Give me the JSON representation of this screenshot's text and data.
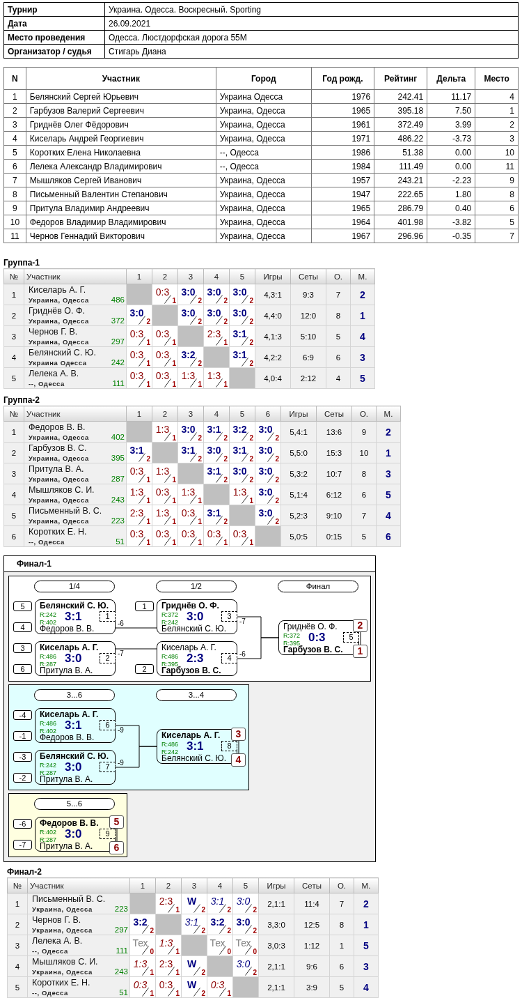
{
  "info": [
    {
      "label": "Турнир",
      "value": "Украина. Одесса. Воскресный. Sporting"
    },
    {
      "label": "Дата",
      "value": "26.09.2021"
    },
    {
      "label": "Место проведения",
      "value": "Одесса. Люстдорфская дорога 55М"
    },
    {
      "label": "Организатор / судья",
      "value": "Стигарь Диана"
    }
  ],
  "participants": {
    "columns": [
      "N",
      "Участник",
      "Город",
      "Год рожд.",
      "Рейтинг",
      "Дельта",
      "Место"
    ],
    "rows": [
      [
        "1",
        "Белянский Сергей Юрьевич",
        "Украина Одесса",
        "1976",
        "242.41",
        "11.17",
        "4"
      ],
      [
        "2",
        "Гарбузов Валерий Сергеевич",
        "Украина, Одесса",
        "1965",
        "395.18",
        "7.50",
        "1"
      ],
      [
        "3",
        "Гриднёв Олег Фёдорович",
        "Украина, Одесса",
        "1961",
        "372.49",
        "3.99",
        "2"
      ],
      [
        "4",
        "Киселарь Андрей Георгиевич",
        "Украина, Одесса",
        "1971",
        "486.22",
        "-3.73",
        "3"
      ],
      [
        "5",
        "Коротких Елена Николаевна",
        "--, Одесса",
        "1986",
        "51.38",
        "0.00",
        "10"
      ],
      [
        "6",
        "Лелека Александр Владимирович",
        "--, Одесса",
        "1984",
        "111.49",
        "0.00",
        "11"
      ],
      [
        "7",
        "Мышляков Сергей Иванович",
        "Украина, Одесса",
        "1957",
        "243.21",
        "-2.23",
        "9"
      ],
      [
        "8",
        "Письменный Валентин Степанович",
        "Украина, Одесса",
        "1947",
        "222.65",
        "1.80",
        "8"
      ],
      [
        "9",
        "Притула Владимир Андреевич",
        "Украина, Одесса",
        "1965",
        "286.79",
        "0.40",
        "6"
      ],
      [
        "10",
        "Федоров Владимир Владимирович",
        "Украина, Одесса",
        "1964",
        "401.98",
        "-3.82",
        "5"
      ],
      [
        "11",
        "Чернов Геннадий Викторович",
        "Украина, Одесса",
        "1967",
        "296.96",
        "-0.35",
        "7"
      ]
    ]
  },
  "groups": [
    {
      "title": "Группа-1",
      "columns": [
        "№",
        "Участник",
        "1",
        "2",
        "3",
        "4",
        "5",
        "Игры",
        "Сеты",
        "О.",
        "М."
      ],
      "rows": [
        {
          "no": "1",
          "name": "Киселарь А. Г.",
          "city": "Украина, Одесса",
          "rating": "486",
          "results": [
            {
              "kind": "blank"
            },
            {
              "kind": "loss",
              "score": "0:3",
              "points": "1"
            },
            {
              "kind": "win",
              "score": "3:0",
              "points": "2"
            },
            {
              "kind": "win",
              "score": "3:0",
              "points": "2"
            },
            {
              "kind": "win",
              "score": "3:0",
              "points": "2"
            }
          ],
          "games": "4,3:1",
          "sets": "9:3",
          "points": "7",
          "place": "2"
        },
        {
          "no": "2",
          "name": "Гриднёв О. Ф.",
          "city": "Украина, Одесса",
          "rating": "372",
          "results": [
            {
              "kind": "win",
              "score": "3:0",
              "points": "2"
            },
            {
              "kind": "blank"
            },
            {
              "kind": "win",
              "score": "3:0",
              "points": "2"
            },
            {
              "kind": "win",
              "score": "3:0",
              "points": "2"
            },
            {
              "kind": "win",
              "score": "3:0",
              "points": "2"
            }
          ],
          "games": "4,4:0",
          "sets": "12:0",
          "points": "8",
          "place": "1"
        },
        {
          "no": "3",
          "name": "Чернов Г. В.",
          "city": "Украина, Одесса",
          "rating": "297",
          "results": [
            {
              "kind": "loss",
              "score": "0:3",
              "points": "1"
            },
            {
              "kind": "loss",
              "score": "0:3",
              "points": "1"
            },
            {
              "kind": "blank"
            },
            {
              "kind": "loss",
              "score": "2:3",
              "points": "1"
            },
            {
              "kind": "win",
              "score": "3:1",
              "points": "2"
            }
          ],
          "games": "4,1:3",
          "sets": "5:10",
          "points": "5",
          "place": "4"
        },
        {
          "no": "4",
          "name": "Белянский С. Ю.",
          "city": "Украина Одесса",
          "rating": "242",
          "results": [
            {
              "kind": "loss",
              "score": "0:3",
              "points": "1"
            },
            {
              "kind": "loss",
              "score": "0:3",
              "points": "1"
            },
            {
              "kind": "win",
              "score": "3:2",
              "points": "2"
            },
            {
              "kind": "blank"
            },
            {
              "kind": "win",
              "score": "3:1",
              "points": "2"
            }
          ],
          "games": "4,2:2",
          "sets": "6:9",
          "points": "6",
          "place": "3"
        },
        {
          "no": "5",
          "name": "Лелека А. В.",
          "city": "--, Одесса",
          "rating": "111",
          "results": [
            {
              "kind": "loss",
              "score": "0:3",
              "points": "1"
            },
            {
              "kind": "loss",
              "score": "0:3",
              "points": "1"
            },
            {
              "kind": "loss",
              "score": "1:3",
              "points": "1"
            },
            {
              "kind": "loss",
              "score": "1:3",
              "points": "1"
            },
            {
              "kind": "blank"
            }
          ],
          "games": "4,0:4",
          "sets": "2:12",
          "points": "4",
          "place": "5"
        }
      ]
    },
    {
      "title": "Группа-2",
      "columns": [
        "№",
        "Участник",
        "1",
        "2",
        "3",
        "4",
        "5",
        "6",
        "Игры",
        "Сеты",
        "О.",
        "М."
      ],
      "rows": [
        {
          "no": "1",
          "name": "Федоров В. В.",
          "city": "Украина, Одесса",
          "rating": "402",
          "results": [
            {
              "kind": "blank"
            },
            {
              "kind": "loss",
              "score": "1:3",
              "points": "1"
            },
            {
              "kind": "win",
              "score": "3:0",
              "points": "2"
            },
            {
              "kind": "win",
              "score": "3:1",
              "points": "2"
            },
            {
              "kind": "win",
              "score": "3:2",
              "points": "2"
            },
            {
              "kind": "win",
              "score": "3:0",
              "points": "2"
            }
          ],
          "games": "5,4:1",
          "sets": "13:6",
          "points": "9",
          "place": "2"
        },
        {
          "no": "2",
          "name": "Гарбузов В. С.",
          "city": "Украина, Одесса",
          "rating": "395",
          "results": [
            {
              "kind": "win",
              "score": "3:1",
              "points": "2"
            },
            {
              "kind": "blank"
            },
            {
              "kind": "win",
              "score": "3:1",
              "points": "2"
            },
            {
              "kind": "win",
              "score": "3:0",
              "points": "2"
            },
            {
              "kind": "win",
              "score": "3:1",
              "points": "2"
            },
            {
              "kind": "win",
              "score": "3:0",
              "points": "2"
            }
          ],
          "games": "5,5:0",
          "sets": "15:3",
          "points": "10",
          "place": "1"
        },
        {
          "no": "3",
          "name": "Притула В. А.",
          "city": "Украина, Одесса",
          "rating": "287",
          "results": [
            {
              "kind": "loss",
              "score": "0:3",
              "points": "1"
            },
            {
              "kind": "loss",
              "score": "1:3",
              "points": "1"
            },
            {
              "kind": "blank"
            },
            {
              "kind": "win",
              "score": "3:1",
              "points": "2"
            },
            {
              "kind": "win",
              "score": "3:0",
              "points": "2"
            },
            {
              "kind": "win",
              "score": "3:0",
              "points": "2"
            }
          ],
          "games": "5,3:2",
          "sets": "10:7",
          "points": "8",
          "place": "3"
        },
        {
          "no": "4",
          "name": "Мышляков С. И.",
          "city": "Украина, Одесса",
          "rating": "243",
          "results": [
            {
              "kind": "loss",
              "score": "1:3",
              "points": "1"
            },
            {
              "kind": "loss",
              "score": "0:3",
              "points": "1"
            },
            {
              "kind": "loss",
              "score": "1:3",
              "points": "1"
            },
            {
              "kind": "blank"
            },
            {
              "kind": "loss",
              "score": "1:3",
              "points": "1"
            },
            {
              "kind": "win",
              "score": "3:0",
              "points": "2"
            }
          ],
          "games": "5,1:4",
          "sets": "6:12",
          "points": "6",
          "place": "5"
        },
        {
          "no": "5",
          "name": "Письменный В. С.",
          "city": "Украина, Одесса",
          "rating": "223",
          "results": [
            {
              "kind": "loss",
              "score": "2:3",
              "points": "1"
            },
            {
              "kind": "loss",
              "score": "1:3",
              "points": "1"
            },
            {
              "kind": "loss",
              "score": "0:3",
              "points": "1"
            },
            {
              "kind": "win",
              "score": "3:1",
              "points": "2"
            },
            {
              "kind": "blank"
            },
            {
              "kind": "win",
              "score": "3:0",
              "points": "2"
            }
          ],
          "games": "5,2:3",
          "sets": "9:10",
          "points": "7",
          "place": "4"
        },
        {
          "no": "6",
          "name": "Коротких Е. Н.",
          "city": "--, Одесса",
          "rating": "51",
          "results": [
            {
              "kind": "loss",
              "score": "0:3",
              "points": "1"
            },
            {
              "kind": "loss",
              "score": "0:3",
              "points": "1"
            },
            {
              "kind": "loss",
              "score": "0:3",
              "points": "1"
            },
            {
              "kind": "loss",
              "score": "0:3",
              "points": "1"
            },
            {
              "kind": "loss",
              "score": "0:3",
              "points": "1"
            },
            {
              "kind": "blank"
            }
          ],
          "games": "5,0:5",
          "sets": "0:15",
          "points": "5",
          "place": "6"
        }
      ]
    }
  ],
  "final1": {
    "title": "Финал-1",
    "panels": [
      {
        "color": "#ffffff",
        "rounds": [
          {
            "label": "1/4",
            "matches": [
              {
                "top": {
                  "name": "Белянский С. Ю.",
                  "rating": "R:242",
                  "winner": true,
                  "seed": "5"
                },
                "bottom": {
                  "name": "Федоров В. В.",
                  "rating": "R:402",
                  "winner": false,
                  "seed": "4"
                },
                "score": "3:1",
                "number": "1",
                "loser": "-6"
              },
              {
                "top": {
                  "name": "Киселарь А. Г.",
                  "rating": "R:486",
                  "winner": true,
                  "seed": "3"
                },
                "bottom": {
                  "name": "Притула В. А.",
                  "rating": "R:287",
                  "winner": false,
                  "seed": "6"
                },
                "score": "3:0",
                "number": "2",
                "loser": "-7"
              }
            ]
          },
          {
            "label": "1/2",
            "matches": [
              {
                "top": {
                  "name": "Гриднёв О. Ф.",
                  "rating": "R:372",
                  "winner": true,
                  "seed": "1"
                },
                "bottom": {
                  "name": "Белянский С. Ю.",
                  "rating": "R:242",
                  "winner": false
                },
                "score": "3:0",
                "number": "3",
                "loser": "-7"
              },
              {
                "top": {
                  "name": "Киселарь А. Г.",
                  "rating": "R:486",
                  "winner": false
                },
                "bottom": {
                  "name": "Гарбузов В. С.",
                  "rating": "R:395",
                  "winner": true,
                  "seed": "2"
                },
                "score": "2:3",
                "number": "4",
                "loser": "-6"
              }
            ]
          },
          {
            "label": "Финал",
            "matches": [
              {
                "top": {
                  "name": "Гриднёв О. Ф.",
                  "rating": "R:372",
                  "winner": false,
                  "place": "2"
                },
                "bottom": {
                  "name": "Гарбузов В. С.",
                  "rating": "R:395",
                  "winner": true,
                  "place": "1"
                },
                "score": "0:3",
                "number": "5"
              }
            ]
          }
        ]
      },
      {
        "color": "#e0ffff",
        "rounds": [
          {
            "label": "3...6",
            "matches": [
              {
                "top": {
                  "name": "Киселарь А. Г.",
                  "rating": "R:486",
                  "winner": true,
                  "seed": "-4"
                },
                "bottom": {
                  "name": "Федоров В. В.",
                  "rating": "R:402",
                  "winner": false,
                  "seed": "-1"
                },
                "score": "3:1",
                "number": "6",
                "loser": "-9"
              },
              {
                "top": {
                  "name": "Белянский С. Ю.",
                  "rating": "R:242",
                  "winner": true,
                  "seed": "-3"
                },
                "bottom": {
                  "name": "Притула В. А.",
                  "rating": "R:287",
                  "winner": false,
                  "seed": "-2"
                },
                "score": "3:0",
                "number": "7",
                "loser": "-9"
              }
            ]
          },
          {
            "label": "3...4",
            "matches": [
              {
                "top": {
                  "name": "Киселарь А. Г.",
                  "rating": "R:486",
                  "winner": true,
                  "place": "3"
                },
                "bottom": {
                  "name": "Белянский С. Ю.",
                  "rating": "R:242",
                  "winner": false,
                  "place": "4"
                },
                "score": "3:1",
                "number": "8"
              }
            ]
          }
        ]
      },
      {
        "color": "#ffffe0",
        "rounds": [
          {
            "label": "5...6",
            "matches": [
              {
                "top": {
                  "name": "Федоров В. В.",
                  "rating": "R:402",
                  "winner": true,
                  "seed": "-6",
                  "place": "5"
                },
                "bottom": {
                  "name": "Притула В. А.",
                  "rating": "R:287",
                  "winner": false,
                  "seed": "-7",
                  "place": "6"
                },
                "score": "3:0",
                "number": "9"
              }
            ]
          }
        ]
      }
    ]
  },
  "final2": {
    "title": "Финал-2",
    "columns": [
      "№",
      "Участник",
      "1",
      "2",
      "3",
      "4",
      "5",
      "Игры",
      "Сеты",
      "О.",
      "М."
    ],
    "rows": [
      {
        "no": "1",
        "name": "Письменный В. С.",
        "city": "Украина, Одесса",
        "rating": "223",
        "results": [
          {
            "kind": "blank"
          },
          {
            "kind": "loss",
            "score": "2:3",
            "points": "1"
          },
          {
            "kind": "win",
            "score": "W",
            "points": "2"
          },
          {
            "kind": "win-prior",
            "score": "3:1",
            "points": "2"
          },
          {
            "kind": "win-prior",
            "score": "3:0",
            "points": "2"
          }
        ],
        "games": "2,1:1",
        "sets": "11:4",
        "points": "7",
        "place": "2"
      },
      {
        "no": "2",
        "name": "Чернов Г. В.",
        "city": "Украина, Одесса",
        "rating": "297",
        "results": [
          {
            "kind": "win",
            "score": "3:2",
            "points": "2"
          },
          {
            "kind": "blank"
          },
          {
            "kind": "win-prior",
            "score": "3:1",
            "points": "2"
          },
          {
            "kind": "win",
            "score": "3:2",
            "points": "2"
          },
          {
            "kind": "win",
            "score": "3:0",
            "points": "2"
          }
        ],
        "games": "3,3:0",
        "sets": "12:5",
        "points": "8",
        "place": "1"
      },
      {
        "no": "3",
        "name": "Лелека А. В.",
        "city": "--, Одесса",
        "rating": "111",
        "results": [
          {
            "kind": "tech",
            "score": "Тех",
            "points": "0"
          },
          {
            "kind": "loss-prior",
            "score": "1:3",
            "points": "1"
          },
          {
            "kind": "blank"
          },
          {
            "kind": "tech",
            "score": "Тех",
            "points": "0"
          },
          {
            "kind": "tech",
            "score": "Тех",
            "points": "0"
          }
        ],
        "games": "3,0:3",
        "sets": "1:12",
        "points": "1",
        "place": "5"
      },
      {
        "no": "4",
        "name": "Мышляков С. И.",
        "city": "Украина, Одесса",
        "rating": "243",
        "results": [
          {
            "kind": "loss-prior",
            "score": "1:3",
            "points": "1"
          },
          {
            "kind": "loss",
            "score": "2:3",
            "points": "1"
          },
          {
            "kind": "win",
            "score": "W",
            "points": "2"
          },
          {
            "kind": "blank"
          },
          {
            "kind": "win-prior",
            "score": "3:0",
            "points": "2"
          }
        ],
        "games": "2,1:1",
        "sets": "9:6",
        "points": "6",
        "place": "3"
      },
      {
        "no": "5",
        "name": "Коротких Е. Н.",
        "city": "--, Одесса",
        "rating": "51",
        "results": [
          {
            "kind": "loss-prior",
            "score": "0:3",
            "points": "1"
          },
          {
            "kind": "loss",
            "score": "0:3",
            "points": "1"
          },
          {
            "kind": "win",
            "score": "W",
            "points": "2"
          },
          {
            "kind": "loss-prior",
            "score": "0:3",
            "points": "1"
          },
          {
            "kind": "blank"
          }
        ],
        "games": "2,1:1",
        "sets": "3:9",
        "points": "5",
        "place": "4"
      }
    ]
  }
}
